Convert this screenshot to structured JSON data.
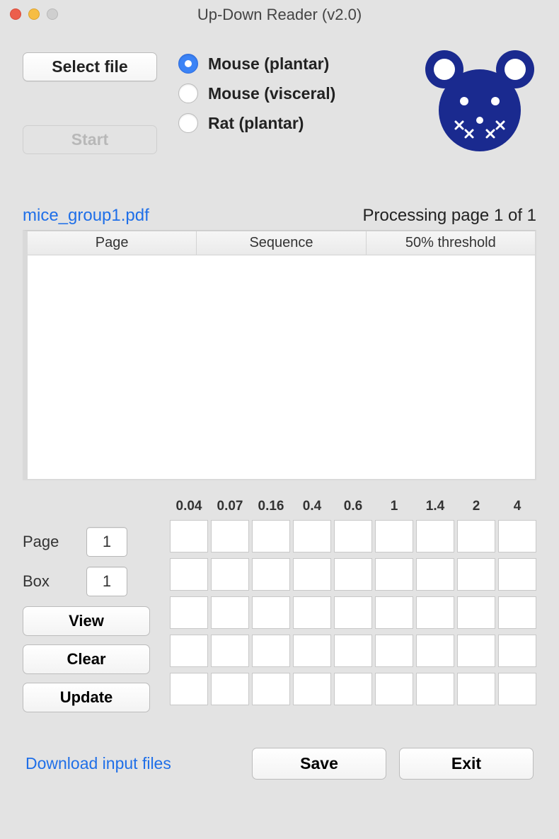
{
  "window": {
    "title": "Up-Down Reader (v2.0)"
  },
  "buttons": {
    "select_file": "Select file",
    "start": "Start",
    "view": "View",
    "clear": "Clear",
    "update": "Update",
    "save": "Save",
    "exit": "Exit"
  },
  "radios": {
    "options": [
      {
        "label": "Mouse (plantar)",
        "selected": true
      },
      {
        "label": "Mouse (visceral)",
        "selected": false
      },
      {
        "label": "Rat (plantar)",
        "selected": false
      }
    ]
  },
  "file": {
    "name": "mice_group1.pdf",
    "status": "Processing page 1 of 1"
  },
  "table": {
    "columns": [
      "Page",
      "Sequence",
      "50% threshold"
    ]
  },
  "inputs": {
    "page_label": "Page",
    "page_value": "1",
    "box_label": "Box",
    "box_value": "1"
  },
  "grid": {
    "headers": [
      "0.04",
      "0.07",
      "0.16",
      "0.4",
      "0.6",
      "1",
      "1.4",
      "2",
      "4"
    ],
    "rows": 5,
    "cols": 9
  },
  "footer": {
    "download": "Download input files"
  }
}
